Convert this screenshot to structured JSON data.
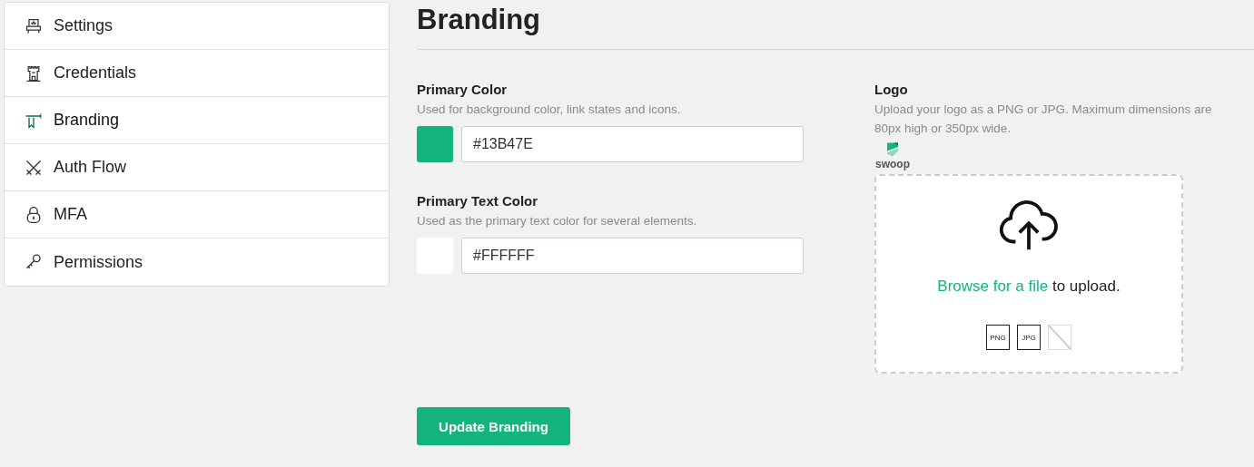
{
  "sidebar": {
    "items": [
      {
        "label": "Settings",
        "selected": false
      },
      {
        "label": "Credentials",
        "selected": false
      },
      {
        "label": "Branding",
        "selected": true
      },
      {
        "label": "Auth Flow",
        "selected": false
      },
      {
        "label": "MFA",
        "selected": false
      },
      {
        "label": "Permissions",
        "selected": false
      }
    ]
  },
  "page": {
    "title": "Branding"
  },
  "color_fields": [
    {
      "label": "Primary Color",
      "hint": "Used for background color, link states and icons.",
      "value": "#13B47E",
      "color": "#13b47e"
    },
    {
      "label": "Primary Text Color",
      "hint": "Used as the primary text color for several elements.",
      "value": "#FFFFFF",
      "color": "#ffffff"
    }
  ],
  "logo": {
    "label": "Logo",
    "hint": "Upload your logo as a PNG or JPG. Maximum dimensions are 80px high or 350px wide.",
    "preview_wordmark": "swoop",
    "dropzone": {
      "link": "Browse for a file",
      "text": " to upload.",
      "file_types": [
        {
          "label": "PNG",
          "supported": true
        },
        {
          "label": "JPG",
          "supported": true
        },
        {
          "supported": false
        }
      ]
    }
  },
  "submit_button": "Update Branding"
}
